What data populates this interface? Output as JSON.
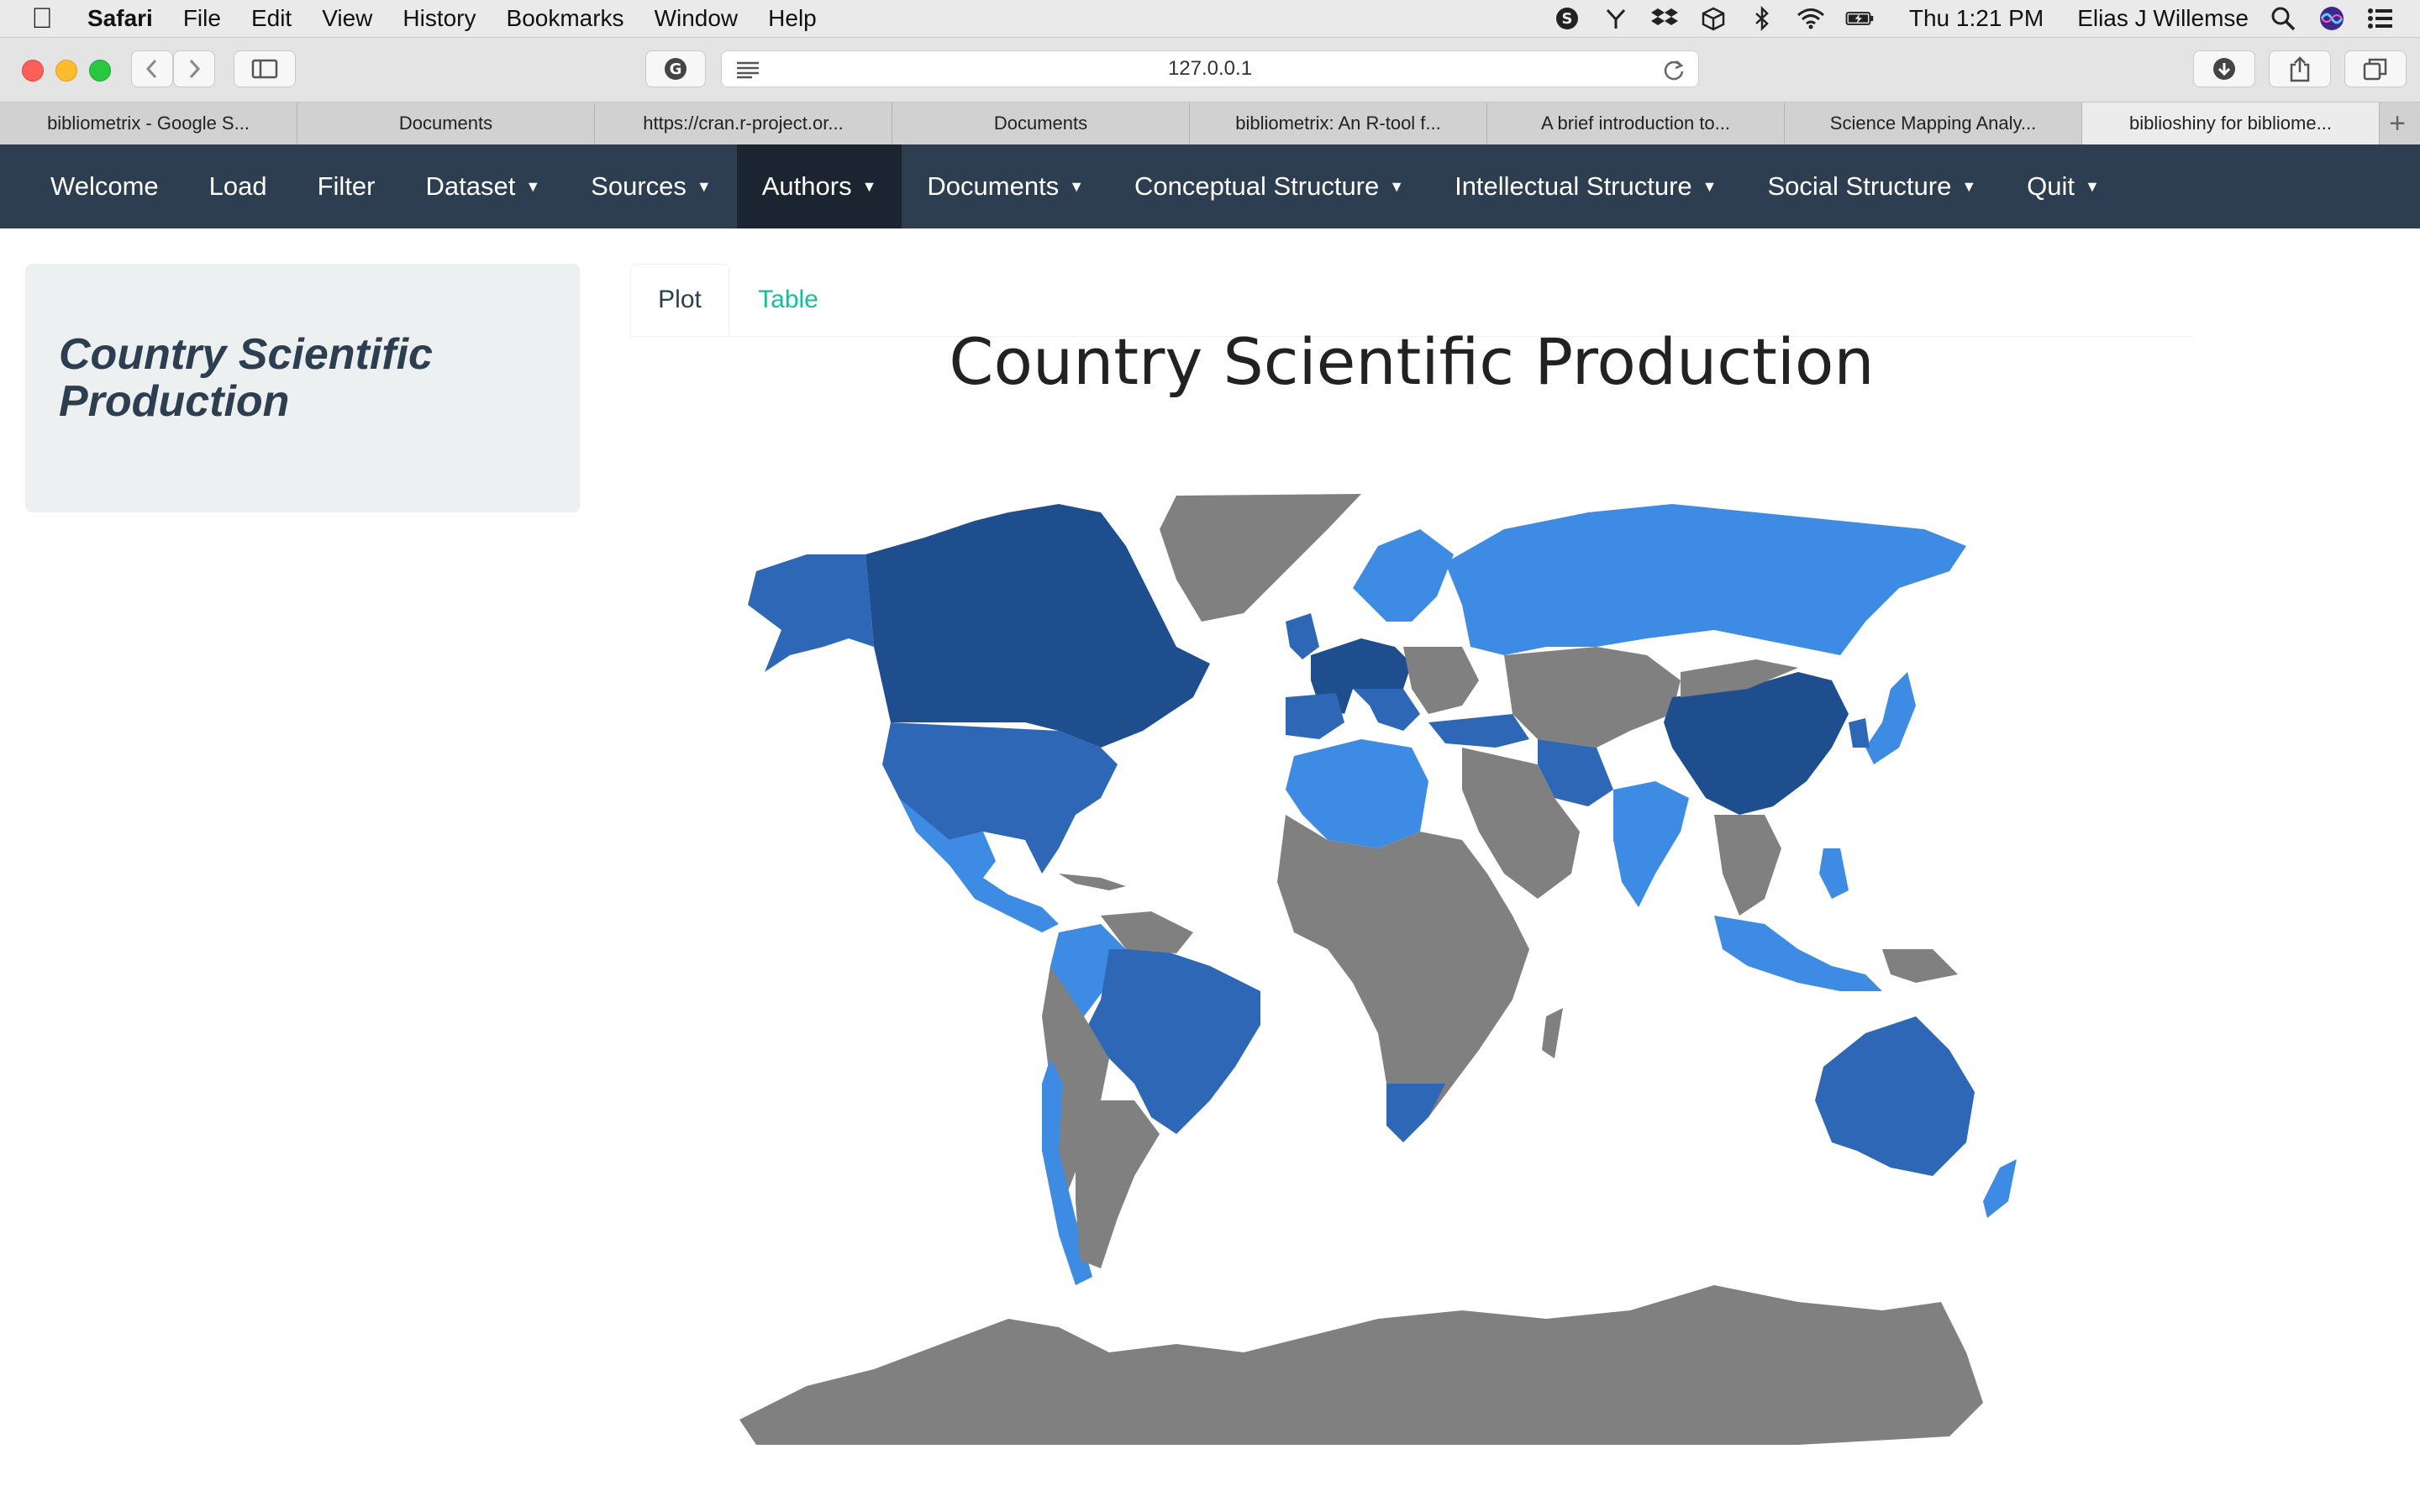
{
  "menubar": {
    "app_name": "Safari",
    "items": [
      "File",
      "Edit",
      "View",
      "History",
      "Bookmarks",
      "Window",
      "Help"
    ],
    "clock": "Thu 1:21 PM",
    "user": "Elias J Willemse"
  },
  "toolbar": {
    "url": "127.0.0.1"
  },
  "tabs": [
    "bibliometrix - Google S...",
    "Documents",
    "https://cran.r-project.or...",
    "Documents",
    "bibliometrix: An R-tool f...",
    "A brief introduction to...",
    "Science Mapping Analy...",
    "biblioshiny for bibliome..."
  ],
  "navbar": {
    "items": [
      {
        "label": "Welcome"
      },
      {
        "label": "Load"
      },
      {
        "label": "Filter"
      },
      {
        "label": "Dataset"
      },
      {
        "label": "Sources"
      },
      {
        "label": "Authors"
      },
      {
        "label": "Documents"
      },
      {
        "label": "Conceptual Structure"
      },
      {
        "label": "Intellectual Structure"
      },
      {
        "label": "Social Structure"
      },
      {
        "label": "Quit"
      }
    ],
    "active": "Authors"
  },
  "sidebar": {
    "title": "Country Scientific Production"
  },
  "content_tabs": {
    "plot": "Plot",
    "table": "Table"
  },
  "plot": {
    "title": "Country Scientific Production"
  },
  "colors": {
    "navbar_bg": "#2c3e50",
    "navbar_active": "#1a252f",
    "no_production": "#808080",
    "low_production": "#3d8be3",
    "mid_production": "#2d67b5",
    "high_production": "#1f4e8f",
    "tab_link": "#18bc9c"
  }
}
